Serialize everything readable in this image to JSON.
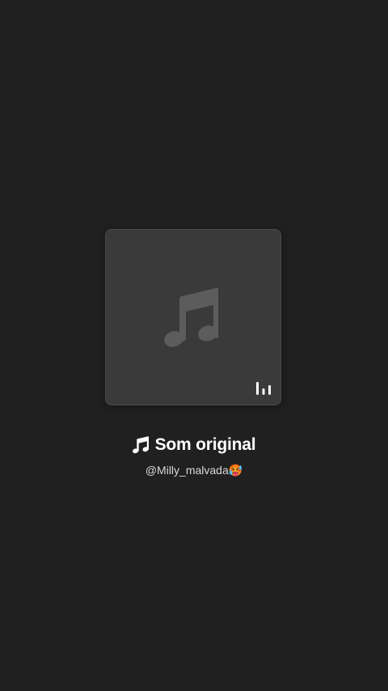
{
  "sound": {
    "title": "Som original",
    "author": "@Milly_malvada🥵"
  },
  "icons": {
    "album_art": "music-note-icon",
    "levels": "audio-levels-icon",
    "title_prefix": "music-note-icon"
  },
  "colors": {
    "background": "#202020",
    "card": "#3a3a3a",
    "note_placeholder": "#5c5c5c",
    "text_primary": "#ffffff",
    "text_secondary": "#d8d8d8"
  }
}
